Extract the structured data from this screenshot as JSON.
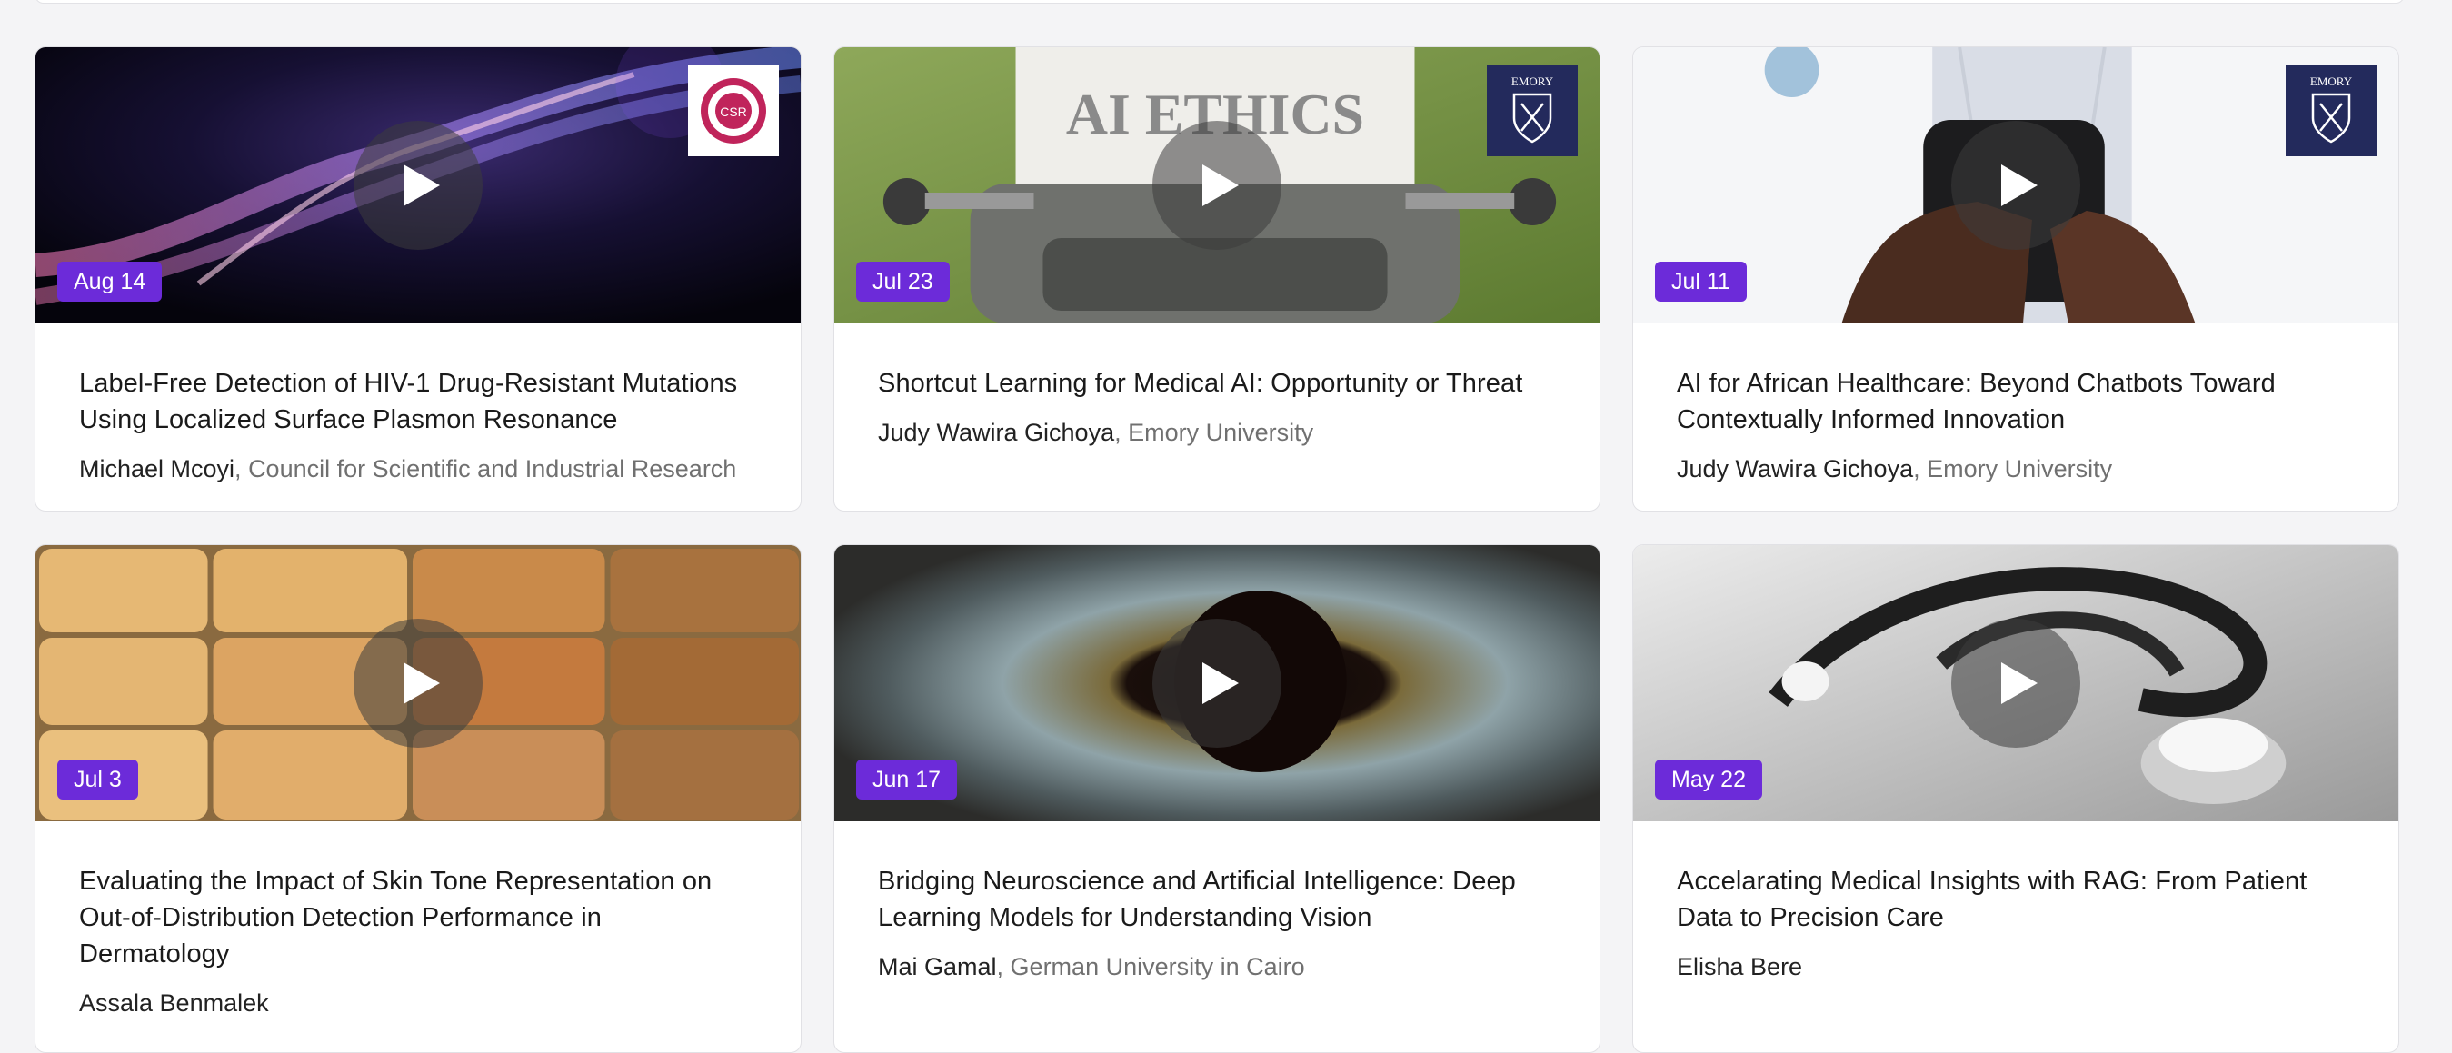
{
  "cards": [
    {
      "date": "Aug 14",
      "title": "Label-Free Detection of HIV-1 Drug-Resistant Mutations Using Localized Surface Plasmon Resonance",
      "author": "Michael Mcoyi",
      "separator": ", ",
      "affiliation": "Council for Scientific and Industrial Research",
      "logo": "csr-logo",
      "logo_text": "CSR",
      "thumbnail": "dna-helix-image"
    },
    {
      "date": "Jul 23",
      "title": "Shortcut Learning for Medical AI: Opportunity or Threat",
      "author": "Judy Wawira Gichoya",
      "separator": ", ",
      "affiliation": "Emory University",
      "logo": "emory-logo",
      "logo_text": "EMORY",
      "thumbnail_text": "AI ETHICS",
      "thumbnail": "typewriter-image"
    },
    {
      "date": "Jul 11",
      "title": "AI for African Healthcare: Beyond Chatbots Toward Contextually Informed Innovation",
      "author": "Judy Wawira Gichoya",
      "separator": ", ",
      "affiliation": "Emory University",
      "logo": "emory-logo",
      "logo_text": "EMORY",
      "thumbnail": "doctor-phone-image"
    },
    {
      "date": "Jul 3",
      "title": "Evaluating the Impact of Skin Tone Representation on Out-of-Distribution Detection Performance in Dermatology",
      "author": "Assala Benmalek",
      "separator": "",
      "affiliation": "",
      "thumbnail": "skin-tone-swatches-image"
    },
    {
      "date": "Jun 17",
      "title": "Bridging Neuroscience and Artificial Intelligence: Deep Learning Models for Understanding Vision",
      "author": "Mai Gamal",
      "separator": ", ",
      "affiliation": "German University in Cairo",
      "thumbnail": "eye-iris-image"
    },
    {
      "date": "May 22",
      "title": "Accelarating Medical Insights with RAG: From Patient Data to Precision Care",
      "author": "Elisha Bere",
      "separator": "",
      "affiliation": "",
      "thumbnail": "stethoscope-image"
    }
  ],
  "colors": {
    "badge": "#6c2bd9",
    "affiliation": "#707070",
    "emory_navy": "#232a5c"
  },
  "icons": {
    "play": "play-icon"
  }
}
